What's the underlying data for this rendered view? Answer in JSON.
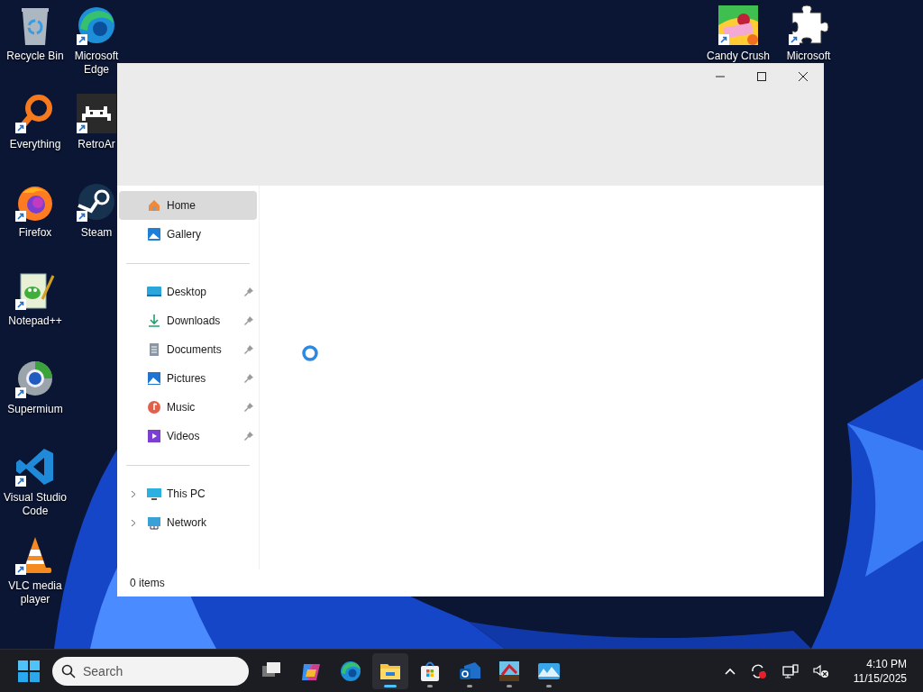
{
  "desktop_icons": [
    {
      "label": "Recycle Bin",
      "shortcut": false
    },
    {
      "label": "Everything",
      "shortcut": true
    },
    {
      "label": "Firefox",
      "shortcut": true
    },
    {
      "label": "Notepad++",
      "shortcut": true
    },
    {
      "label": "Supermium",
      "shortcut": true
    },
    {
      "label": "Visual Studio Code",
      "shortcut": true
    },
    {
      "label": "VLC media player",
      "shortcut": true
    },
    {
      "label": "Microsoft Edge",
      "shortcut": true
    },
    {
      "label": "RetroAr",
      "shortcut": true
    },
    {
      "label": "Steam",
      "shortcut": true
    },
    {
      "label": "Candy Crush",
      "shortcut": true
    },
    {
      "label": "Microsoft",
      "shortcut": true
    }
  ],
  "window": {
    "sidebar": {
      "sections": [
        {
          "items": [
            {
              "label": "Home",
              "selected": true,
              "pinned": false
            },
            {
              "label": "Gallery",
              "selected": false,
              "pinned": false
            }
          ]
        },
        {
          "items": [
            {
              "label": "Desktop",
              "selected": false,
              "pinned": true
            },
            {
              "label": "Downloads",
              "selected": false,
              "pinned": true
            },
            {
              "label": "Documents",
              "selected": false,
              "pinned": true
            },
            {
              "label": "Pictures",
              "selected": false,
              "pinned": true
            },
            {
              "label": "Music",
              "selected": false,
              "pinned": true
            },
            {
              "label": "Videos",
              "selected": false,
              "pinned": true
            }
          ]
        },
        {
          "items": [
            {
              "label": "This PC",
              "selected": false,
              "pinned": false,
              "expandable": true
            },
            {
              "label": "Network",
              "selected": false,
              "pinned": false,
              "expandable": true
            }
          ]
        }
      ]
    },
    "loading": true,
    "status_bar": "0 items"
  },
  "taskbar": {
    "search": {
      "placeholder": "Search"
    },
    "apps": [
      {
        "selected": false,
        "running": false
      },
      {
        "selected": false,
        "running": false
      },
      {
        "selected": false,
        "running": false
      },
      {
        "selected": true,
        "running": true
      },
      {
        "selected": false,
        "running": true
      },
      {
        "selected": false,
        "running": true
      },
      {
        "selected": false,
        "running": true
      },
      {
        "selected": false,
        "running": true
      }
    ],
    "clock": {
      "time": "4:10 PM",
      "date": "11/15/2025"
    }
  }
}
